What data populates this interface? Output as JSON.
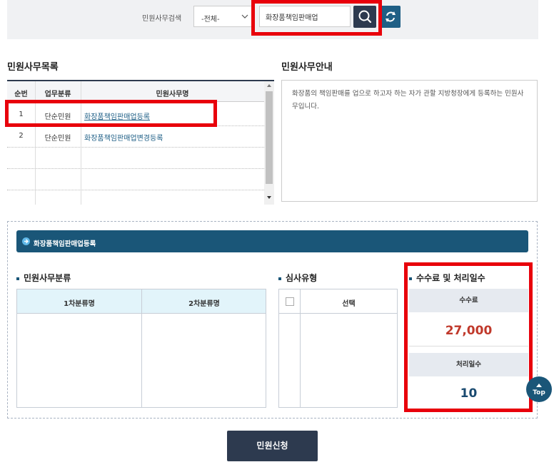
{
  "search": {
    "label": "민원사무검색",
    "select_value": "-전체-",
    "input_value": "화장품책임판매업"
  },
  "list": {
    "title": "민원사무목록",
    "columns": [
      "순번",
      "업무분류",
      "민원사무명"
    ],
    "rows": [
      {
        "no": "1",
        "category": "단순민원",
        "name": "화장품책임판매업등록"
      },
      {
        "no": "2",
        "category": "단순민원",
        "name": "화장품책임판매업변경등록"
      }
    ]
  },
  "info": {
    "title": "민원사무안내",
    "text": "화장품의 책임판매를 업으로 하고자 하는 자가 관할 지방청장에게 등록하는 민원사무입니다."
  },
  "detail": {
    "banner": "화장품책임판매업등록",
    "category_title": "민원사무분류",
    "category_columns": [
      "1차분류명",
      "2차분류명"
    ],
    "review_title": "심사유형",
    "review_column": "선택",
    "fee_title": "수수료 및 처리일수",
    "fee_label": "수수료",
    "fee_value": "27,000",
    "days_label": "처리일수",
    "days_value": "10"
  },
  "apply_label": "민원신청",
  "top_label": "Top",
  "colors": {
    "dark": "#2d3a4f",
    "accent": "#1a5678",
    "fee": "#c0392b",
    "highlight": "#e8000b"
  }
}
